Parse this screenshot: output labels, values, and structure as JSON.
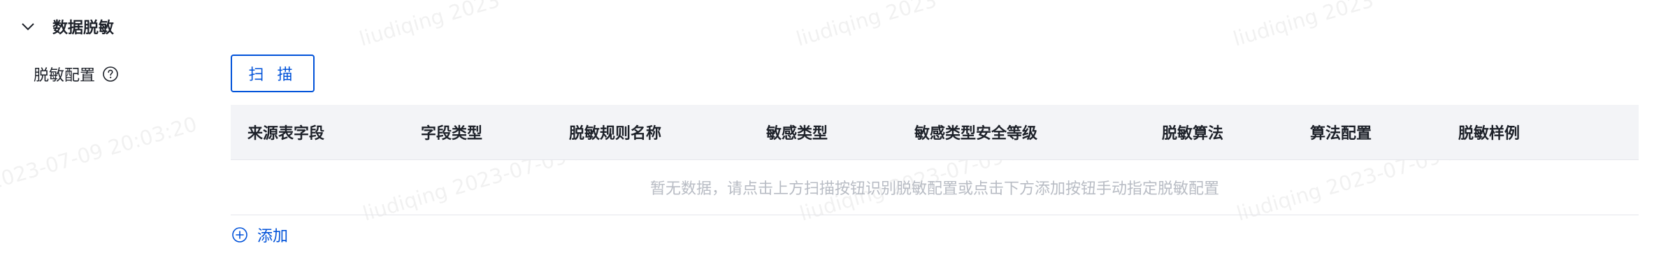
{
  "watermark": {
    "user": "liudiqing",
    "full": "liudiqing 2023-07-09 20:03:20",
    "partial_top": "liudiqing 2023",
    "date_fragment": "2023-07-09 20:03:20"
  },
  "section": {
    "title": "数据脱敏",
    "icon": "chevron-down-icon"
  },
  "form": {
    "label": "脱敏配置",
    "help_icon": "question-circle-icon",
    "scan_button": "扫 描"
  },
  "table": {
    "columns": [
      "来源表字段",
      "字段类型",
      "脱敏规则名称",
      "敏感类型",
      "敏感类型安全等级",
      "脱敏算法",
      "算法配置",
      "脱敏样例"
    ],
    "empty_text": "暂无数据，请点击上方扫描按钮识别脱敏配置或点击下方添加按钮手动指定脱敏配置"
  },
  "add": {
    "label": "添加",
    "icon": "plus-circle-icon"
  },
  "colors": {
    "primary": "#0052d9",
    "header_bg": "#f3f4f7",
    "empty_text": "#b8bcc4"
  }
}
